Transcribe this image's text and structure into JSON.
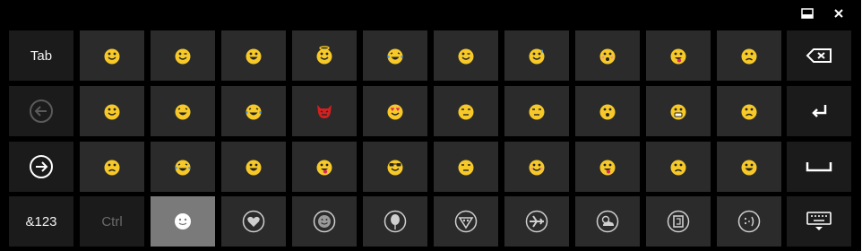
{
  "keys": {
    "tab": "Tab",
    "numbers": "&123",
    "ctrl": "Ctrl"
  },
  "emoji_rows": [
    [
      "smile",
      "wink",
      "grin",
      "halo",
      "tears-of-joy",
      "smirk",
      "sweat",
      "flushed",
      "tongue",
      "disappointed"
    ],
    [
      "smile",
      "laugh",
      "tears-of-joy",
      "devil",
      "heart-eyes",
      "neutral",
      "unamused",
      "surprised",
      "fearful",
      "sad"
    ],
    [
      "frown",
      "tears-of-joy",
      "grin",
      "tongue-wink",
      "sunglasses",
      "unamused",
      "blush",
      "tongue",
      "sad",
      "grin"
    ]
  ],
  "categories": [
    "smiley",
    "heart",
    "face",
    "balloon",
    "food",
    "airplane",
    "weather",
    "symbols",
    "emoticon"
  ],
  "colors": {
    "key": "#2b2b2b",
    "func_key": "#1b1b1b",
    "active_key": "#7a7a7a",
    "emoji_face": "#f7c928",
    "devil": "#d32020"
  }
}
